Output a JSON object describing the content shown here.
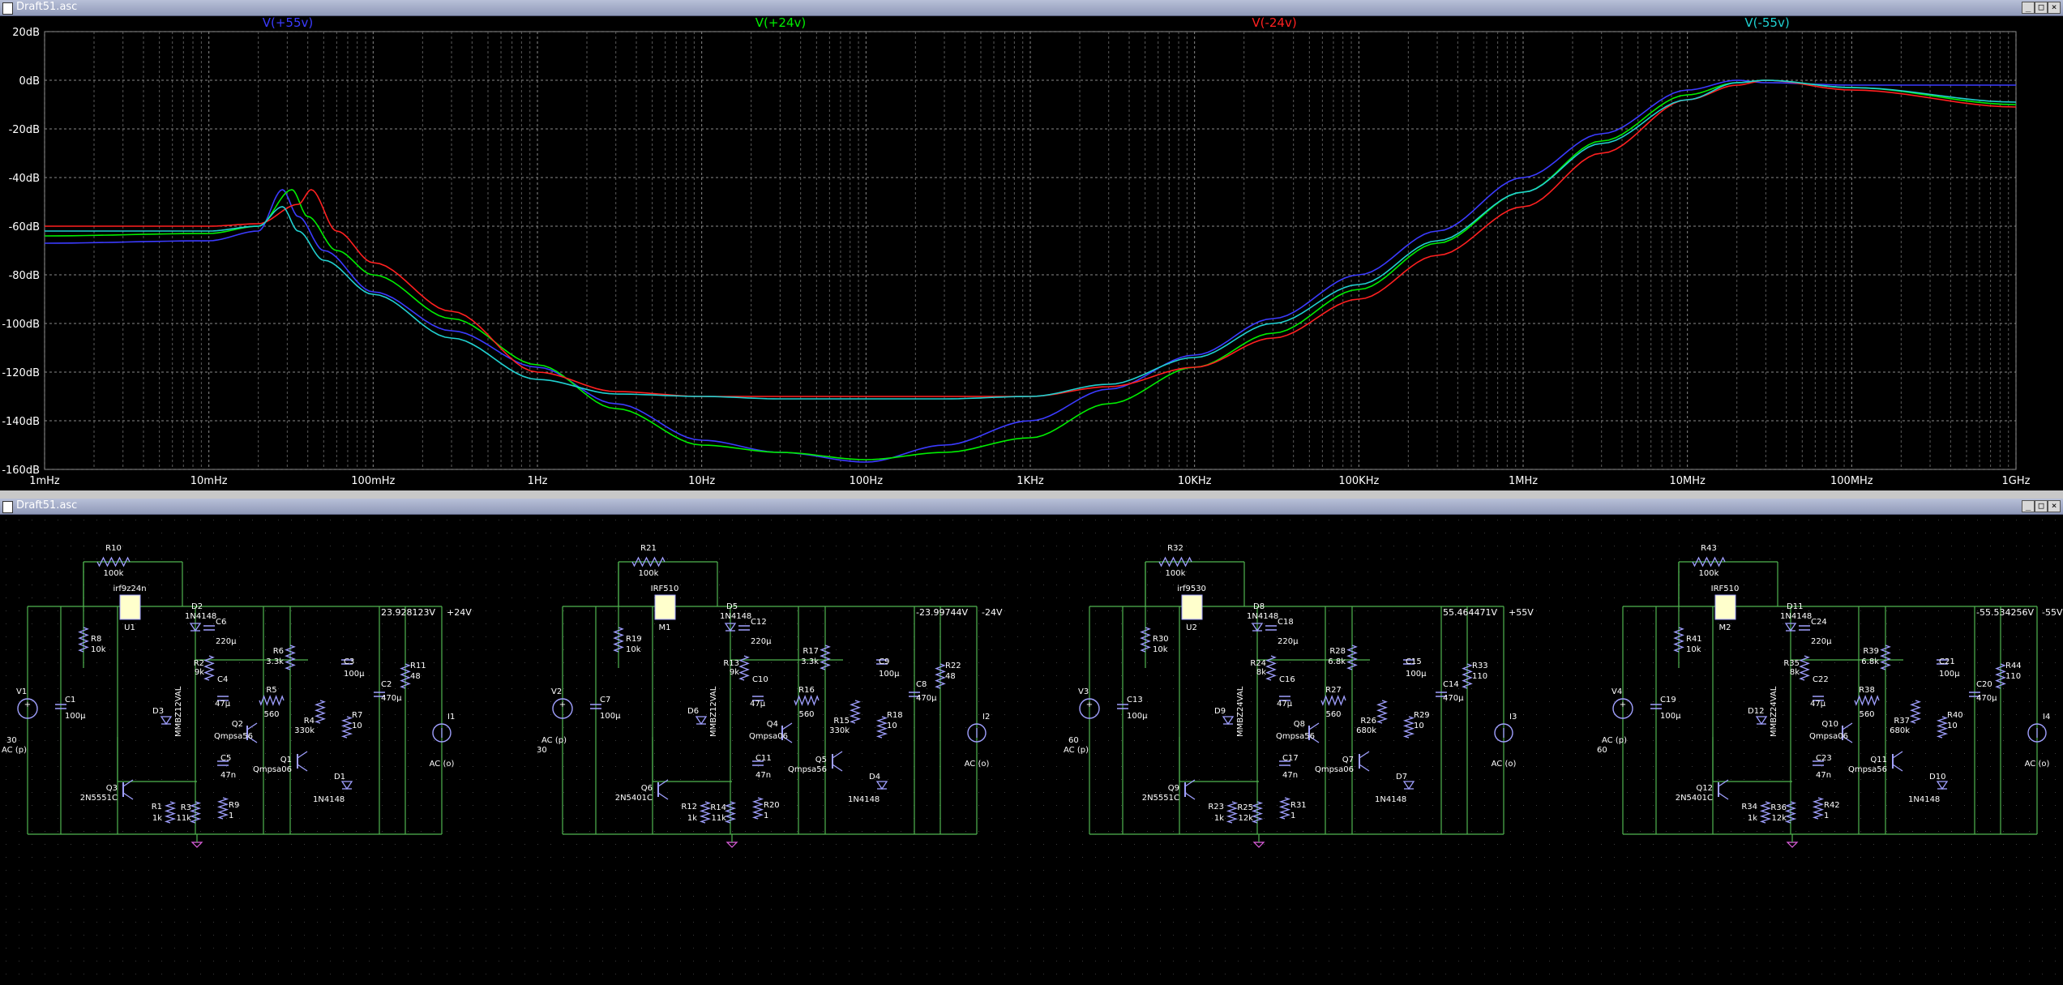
{
  "plot_window": {
    "title": "Draft51.asc",
    "buttons": [
      "_",
      "□",
      "×"
    ]
  },
  "schematic_window": {
    "title": "Draft51.asc",
    "buttons": [
      "_",
      "□",
      "×"
    ]
  },
  "chart_data": {
    "type": "line",
    "x_scale": "log",
    "x_ticks": [
      "1mHz",
      "10mHz",
      "100mHz",
      "1Hz",
      "10Hz",
      "100Hz",
      "1KHz",
      "10KHz",
      "100KHz",
      "1MHz",
      "10MHz",
      "100MHz",
      "1GHz"
    ],
    "y_ticks": [
      "20dB",
      "0dB",
      "-20dB",
      "-40dB",
      "-60dB",
      "-80dB",
      "-100dB",
      "-120dB",
      "-140dB",
      "-160dB"
    ],
    "xlim_hz": [
      0.001,
      1000000000
    ],
    "ylim_db": [
      -160,
      20
    ],
    "grid": true,
    "series": [
      {
        "name": "V(+55v)",
        "color": "#3b3bff",
        "x": [
          0.001,
          0.01,
          0.02,
          0.028,
          0.035,
          0.05,
          0.1,
          0.3,
          1,
          3,
          10,
          30,
          100,
          300,
          1000,
          3000,
          10000,
          30000,
          100000,
          300000,
          1000000,
          3000000,
          10000000,
          20000000,
          30000000,
          100000000,
          1000000000
        ],
        "y": [
          -67,
          -66,
          -62,
          -45,
          -56,
          -70,
          -87,
          -103,
          -118,
          -133,
          -148,
          -153,
          -157,
          -150,
          -140,
          -127,
          -113,
          -98,
          -80,
          -62,
          -40,
          -22,
          -4,
          0,
          -1,
          -2,
          -2
        ]
      },
      {
        "name": "V(+24v)",
        "color": "#00ee00",
        "x": [
          0.001,
          0.01,
          0.02,
          0.032,
          0.04,
          0.06,
          0.1,
          0.3,
          1,
          3,
          10,
          30,
          100,
          300,
          1000,
          3000,
          10000,
          30000,
          100000,
          300000,
          1000000,
          3000000,
          10000000,
          20000000,
          30000000,
          100000000,
          1000000000
        ],
        "y": [
          -64,
          -63,
          -60,
          -45,
          -56,
          -70,
          -80,
          -98,
          -117,
          -135,
          -150,
          -153,
          -156,
          -153,
          -147,
          -133,
          -118,
          -104,
          -86,
          -67,
          -46,
          -25,
          -6,
          -1,
          0,
          -3,
          -10
        ]
      },
      {
        "name": "V(-24v)",
        "color": "#ff2020",
        "x": [
          0.001,
          0.01,
          0.02,
          0.035,
          0.042,
          0.06,
          0.1,
          0.3,
          1,
          3,
          10,
          30,
          100,
          300,
          1000,
          3000,
          10000,
          30000,
          100000,
          300000,
          1000000,
          3000000,
          10000000,
          20000000,
          30000000,
          100000000,
          1000000000
        ],
        "y": [
          -60,
          -60,
          -59,
          -51,
          -45,
          -62,
          -75,
          -95,
          -120,
          -128,
          -130,
          -130,
          -130,
          -130,
          -130,
          -126,
          -118,
          -106,
          -90,
          -72,
          -52,
          -30,
          -8,
          -2,
          0,
          -4,
          -11
        ]
      },
      {
        "name": "V(-55v)",
        "color": "#20d0d0",
        "x": [
          0.001,
          0.01,
          0.02,
          0.028,
          0.035,
          0.05,
          0.1,
          0.3,
          1,
          3,
          10,
          30,
          100,
          300,
          1000,
          3000,
          10000,
          30000,
          100000,
          300000,
          1000000,
          3000000,
          10000000,
          20000000,
          30000000,
          100000000,
          1000000000
        ],
        "y": [
          -62,
          -62,
          -60,
          -52,
          -62,
          -74,
          -88,
          -106,
          -123,
          -129,
          -130,
          -131,
          -131,
          -131,
          -130,
          -125,
          -114,
          -100,
          -84,
          -66,
          -46,
          -26,
          -8,
          -1,
          0,
          -3,
          -9
        ]
      }
    ]
  },
  "circuits": [
    {
      "src": "V1",
      "src_val1": "30",
      "src_val2": "AC (p)",
      "c_in": "C1",
      "c_in_val": "100µ",
      "r_top": "R10",
      "r_top_val": "100k",
      "mos": "U1",
      "mos_val": "irf9z24n",
      "r_gate": "R8",
      "r_gate_val": "10k",
      "diode_a": "D2",
      "diode_a_val": "1N4148",
      "zener": "D3",
      "zener_val": "MMBZ12VAL",
      "cap_a": "C6",
      "cap_a_val": "220µ",
      "r_a": "R2",
      "r_a_val": "9k",
      "cap_b": "C4",
      "cap_b_val": "47µ",
      "cap_c": "C5",
      "cap_c_val": "47n",
      "r_b": "R9",
      "r_b_val": "1",
      "r_c": "R6",
      "r_c_val": "3.3k",
      "r_d": "R5",
      "r_d_val": "560",
      "r_e": "R4",
      "r_e_val": "330k",
      "q_a": "Q2",
      "q_a_val": "Qmpsa56",
      "q_b": "Q1",
      "q_b_val": "Qmpsa06",
      "q_c": "Q3",
      "q_c_val": "2N5551C",
      "r_f": "R1",
      "r_f_val": "1k",
      "r_g": "R3",
      "r_g_val": "11k",
      "cap_d": "C3",
      "cap_d_val": "100µ",
      "r_h": "R7",
      "r_h_val": "10",
      "diode_b": "D1",
      "diode_b_val": "1N4148",
      "cap_e": "C2",
      "cap_e_val": "470µ",
      "r_load": "R11",
      "r_load_val": "48",
      "isrc": "I1",
      "isrc_val": "AC (o)",
      "node_v": "23.928123V",
      "rail": "+24V"
    },
    {
      "src": "V2",
      "src_val1": "AC (p)",
      "src_val2": "30",
      "c_in": "C7",
      "c_in_val": "100µ",
      "r_top": "R21",
      "r_top_val": "100k",
      "mos": "M1",
      "mos_val": "IRF510",
      "r_gate": "R19",
      "r_gate_val": "10k",
      "diode_a": "D5",
      "diode_a_val": "1N4148",
      "zener": "D6",
      "zener_val": "MMBZ12VAL",
      "cap_a": "C12",
      "cap_a_val": "220µ",
      "r_a": "R13",
      "r_a_val": "9k",
      "cap_b": "C10",
      "cap_b_val": "47µ",
      "cap_c": "C11",
      "cap_c_val": "47n",
      "r_b": "R20",
      "r_b_val": "1",
      "r_c": "R17",
      "r_c_val": "3.3k",
      "r_d": "R16",
      "r_d_val": "560",
      "r_e": "R15",
      "r_e_val": "330k",
      "q_a": "Q4",
      "q_a_val": "Qmpsa06",
      "q_b": "Q5",
      "q_b_val": "Qmpsa56",
      "q_c": "Q6",
      "q_c_val": "2N5401C",
      "r_f": "R12",
      "r_f_val": "1k",
      "r_g": "R14",
      "r_g_val": "11k",
      "cap_d": "C9",
      "cap_d_val": "100µ",
      "r_h": "R18",
      "r_h_val": "10",
      "diode_b": "D4",
      "diode_b_val": "1N4148",
      "cap_e": "C8",
      "cap_e_val": "470µ",
      "r_load": "R22",
      "r_load_val": "48",
      "isrc": "I2",
      "isrc_val": "AC (o)",
      "node_v": "-23.99744V",
      "rail": "-24V"
    },
    {
      "src": "V3",
      "src_val1": "60",
      "src_val2": "AC (p)",
      "c_in": "C13",
      "c_in_val": "100µ",
      "r_top": "R32",
      "r_top_val": "100k",
      "mos": "U2",
      "mos_val": "irf9530",
      "r_gate": "R30",
      "r_gate_val": "10k",
      "diode_a": "D8",
      "diode_a_val": "1N4148",
      "zener": "D9",
      "zener_val": "MMBZ24VAL",
      "cap_a": "C18",
      "cap_a_val": "220µ",
      "r_a": "R24",
      "r_a_val": "8k",
      "cap_b": "C16",
      "cap_b_val": "47µ",
      "cap_c": "C17",
      "cap_c_val": "47n",
      "r_b": "R31",
      "r_b_val": "1",
      "r_c": "R28",
      "r_c_val": "6.8k",
      "r_d": "R27",
      "r_d_val": "560",
      "r_e": "R26",
      "r_e_val": "680k",
      "q_a": "Q8",
      "q_a_val": "Qmpsa56",
      "q_b": "Q7",
      "q_b_val": "Qmpsa06",
      "q_c": "Q9",
      "q_c_val": "2N5551C",
      "r_f": "R23",
      "r_f_val": "1k",
      "r_g": "R25",
      "r_g_val": "12k",
      "cap_d": "C15",
      "cap_d_val": "100µ",
      "r_h": "R29",
      "r_h_val": "10",
      "diode_b": "D7",
      "diode_b_val": "1N4148",
      "cap_e": "C14",
      "cap_e_val": "470µ",
      "r_load": "R33",
      "r_load_val": "110",
      "isrc": "I3",
      "isrc_val": "AC (o)",
      "node_v": "55.464471V",
      "rail": "+55V"
    },
    {
      "src": "V4",
      "src_val1": "AC (p)",
      "src_val2": "60",
      "c_in": "C19",
      "c_in_val": "100µ",
      "r_top": "R43",
      "r_top_val": "100k",
      "mos": "M2",
      "mos_val": "IRF510",
      "r_gate": "R41",
      "r_gate_val": "10k",
      "diode_a": "D11",
      "diode_a_val": "1N4148",
      "zener": "D12",
      "zener_val": "MMBZ24VAL",
      "cap_a": "C24",
      "cap_a_val": "220µ",
      "r_a": "R35",
      "r_a_val": "8k",
      "cap_b": "C22",
      "cap_b_val": "47µ",
      "cap_c": "C23",
      "cap_c_val": "47n",
      "r_b": "R42",
      "r_b_val": "1",
      "r_c": "R39",
      "r_c_val": "6.8k",
      "r_d": "R38",
      "r_d_val": "560",
      "r_e": "R37",
      "r_e_val": "680k",
      "q_a": "Q10",
      "q_a_val": "Qmpsa06",
      "q_b": "Q11",
      "q_b_val": "Qmpsa56",
      "q_c": "Q12",
      "q_c_val": "2N5401C",
      "r_f": "R34",
      "r_f_val": "1k",
      "r_g": "R36",
      "r_g_val": "12k",
      "cap_d": "C21",
      "cap_d_val": "100µ",
      "r_h": "R40",
      "r_h_val": "10",
      "diode_b": "D10",
      "diode_b_val": "1N4148",
      "cap_e": "C20",
      "cap_e_val": "470µ",
      "r_load": "R44",
      "r_load_val": "110",
      "isrc": "I4",
      "isrc_val": "AC (o)",
      "node_v": "-55.534256V",
      "rail": "-55V"
    }
  ],
  "colors": {
    "wire": "#4fb54f",
    "component": "#a0a0ff",
    "label": "#ffffff",
    "node_label": "#e040e0",
    "rail_label": "#ff8040",
    "mos_body": "#ffffcc"
  }
}
